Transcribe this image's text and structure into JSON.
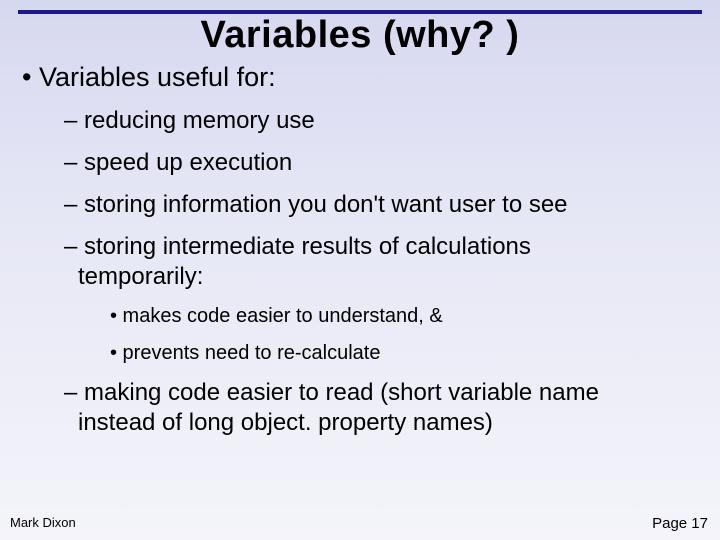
{
  "title": "Variables (why? )",
  "l1": "• Variables useful for:",
  "items": [
    "– reducing memory use",
    "– speed up execution",
    "– storing information you don't want user to see",
    "– storing intermediate results of calculations",
    "temporarily:"
  ],
  "sub": [
    "•  makes code easier to understand, &",
    "•  prevents need to re-calculate"
  ],
  "last": "– making code easier to read (short variable name",
  "last2": "instead of long object. property names)",
  "footer": {
    "left": "Mark Dixon",
    "right": "Page 17"
  }
}
